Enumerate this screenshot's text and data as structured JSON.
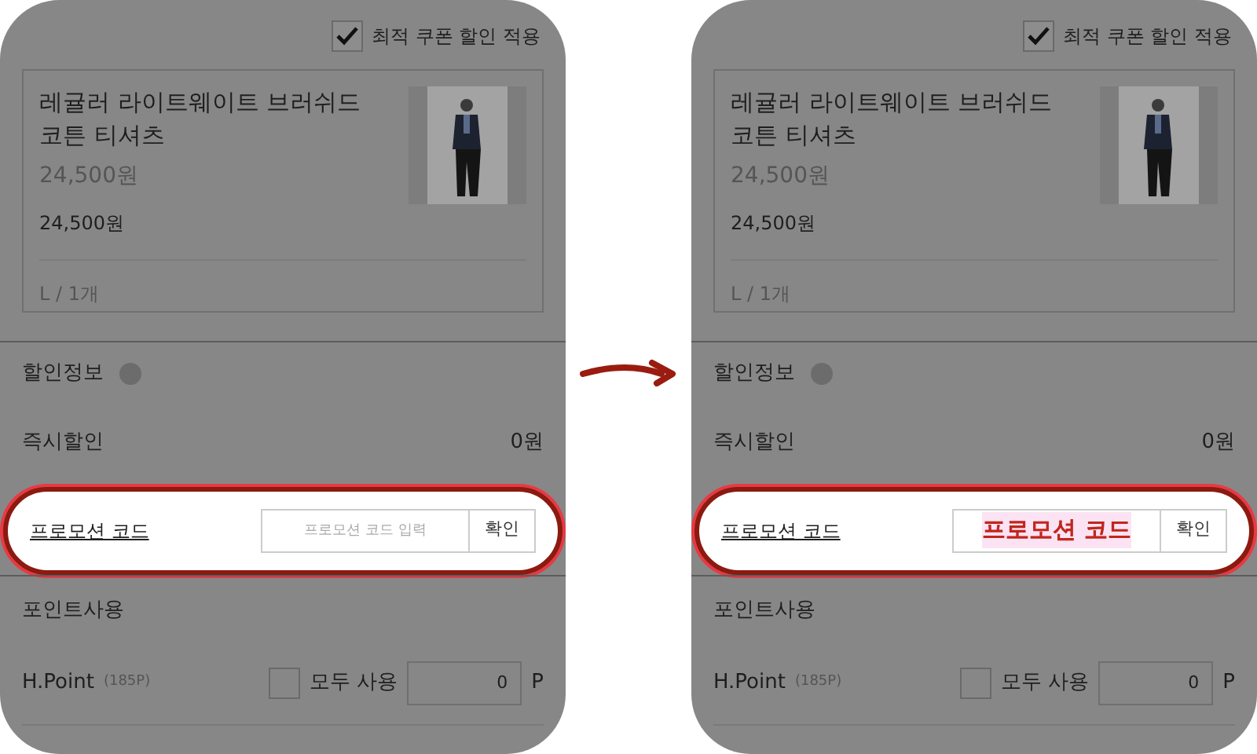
{
  "panels": [
    {
      "coupon": {
        "label": "최적 쿠폰 할인 적용",
        "checked": true
      },
      "product": {
        "name": "레귤러 라이트웨이트 브러쉬드 코튼 티셔츠",
        "price_original": "24,500원",
        "price": "24,500원",
        "option": "L / 1개"
      },
      "discount": {
        "title": "할인정보",
        "rows": [
          {
            "label": "즉시할인",
            "value": "0원"
          }
        ]
      },
      "promo": {
        "label": "프로모션 코드",
        "placeholder": "프로모션 코드 입력",
        "button": "확인",
        "highlighted": true
      },
      "points": {
        "title": "포인트사용",
        "rows": [
          {
            "label": "H.Point",
            "balance": "(185P)",
            "all_label": "모두 사용",
            "checked": false,
            "value": "0",
            "unit": "P"
          }
        ]
      }
    },
    {
      "coupon": {
        "label": "최적 쿠폰 할인 적용",
        "checked": true
      },
      "product": {
        "name": "레귤러 라이트웨이트 브러쉬드 코튼 티셔츠",
        "price_original": "24,500원",
        "price": "24,500원",
        "option": "L / 1개"
      },
      "discount": {
        "title": "할인정보",
        "rows": [
          {
            "label": "즉시할인",
            "value": "0원"
          }
        ]
      },
      "promo": {
        "label": "프로모션 코드",
        "annotation": "프로모션 코드",
        "button": "확인",
        "highlighted": true
      },
      "points": {
        "title": "포인트사용",
        "rows": [
          {
            "label": "H.Point",
            "balance": "(185P)",
            "all_label": "모두 사용",
            "checked": false,
            "value": "0",
            "unit": "P"
          }
        ]
      }
    }
  ]
}
